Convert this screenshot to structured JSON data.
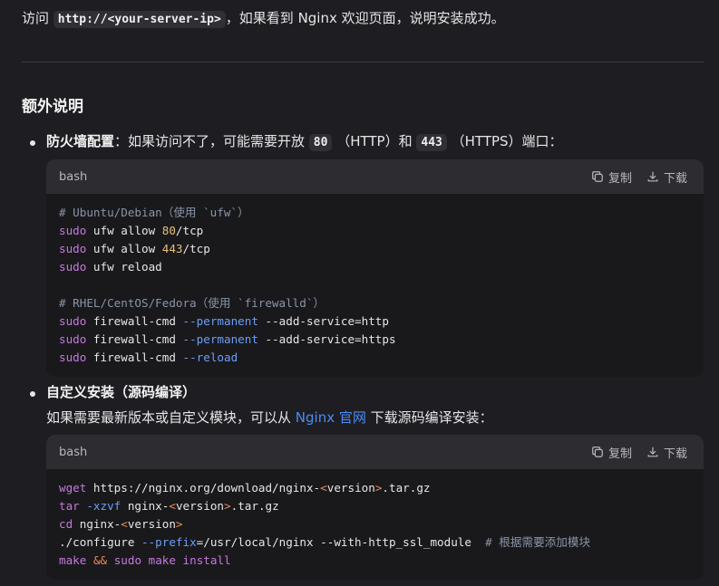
{
  "intro": {
    "prefix": "访问 ",
    "code": "http://<your-server-ip>",
    "suffix": "，如果看到 Nginx 欢迎页面，说明安装成功。"
  },
  "section_title": "额外说明",
  "firewall_item": {
    "bold": "防火墙配置",
    "text1": "：如果访问不了，可能需要开放 ",
    "code1": "80",
    "text2": " （HTTP）和 ",
    "code2": "443",
    "text3": " （HTTPS）端口："
  },
  "code_block_1": {
    "lang": "bash",
    "copy_label": "复制",
    "download_label": "下载",
    "lines": [
      [
        {
          "t": "# Ubuntu/Debian（使用 `ufw`）",
          "c": "com"
        }
      ],
      [
        {
          "t": "sudo",
          "c": "kw"
        },
        {
          "t": " ufw allow "
        },
        {
          "t": "80",
          "c": "num"
        },
        {
          "t": "/tcp"
        }
      ],
      [
        {
          "t": "sudo",
          "c": "kw"
        },
        {
          "t": " ufw allow "
        },
        {
          "t": "443",
          "c": "num"
        },
        {
          "t": "/tcp"
        }
      ],
      [
        {
          "t": "sudo",
          "c": "kw"
        },
        {
          "t": " ufw reload"
        }
      ],
      [],
      [
        {
          "t": "# RHEL/CentOS/Fedora（使用 `firewalld`）",
          "c": "com"
        }
      ],
      [
        {
          "t": "sudo",
          "c": "kw"
        },
        {
          "t": " firewall-cmd "
        },
        {
          "t": "--permanent",
          "c": "flag"
        },
        {
          "t": " --add-service=http"
        }
      ],
      [
        {
          "t": "sudo",
          "c": "kw"
        },
        {
          "t": " firewall-cmd "
        },
        {
          "t": "--permanent",
          "c": "flag"
        },
        {
          "t": " --add-service=https"
        }
      ],
      [
        {
          "t": "sudo",
          "c": "kw"
        },
        {
          "t": " firewall-cmd "
        },
        {
          "t": "--reload",
          "c": "flag"
        }
      ]
    ]
  },
  "custom_item": {
    "bold": "自定义安装（源码编译）",
    "desc_prefix": "如果需要最新版本或自定义模块，可以从 ",
    "link": "Nginx 官网",
    "desc_suffix": " 下载源码编译安装："
  },
  "code_block_2": {
    "lang": "bash",
    "copy_label": "复制",
    "download_label": "下载",
    "lines": [
      [
        {
          "t": "wget",
          "c": "kw"
        },
        {
          "t": " https://nginx.org/download/nginx-"
        },
        {
          "t": "<",
          "c": "op"
        },
        {
          "t": "version"
        },
        {
          "t": ">",
          "c": "op"
        },
        {
          "t": ".tar.gz"
        }
      ],
      [
        {
          "t": "tar",
          "c": "kw"
        },
        {
          "t": " "
        },
        {
          "t": "-xzvf",
          "c": "flag"
        },
        {
          "t": " nginx-"
        },
        {
          "t": "<",
          "c": "op"
        },
        {
          "t": "version"
        },
        {
          "t": ">",
          "c": "op"
        },
        {
          "t": ".tar.gz"
        }
      ],
      [
        {
          "t": "cd",
          "c": "kw"
        },
        {
          "t": " nginx-"
        },
        {
          "t": "<",
          "c": "op"
        },
        {
          "t": "version"
        },
        {
          "t": ">",
          "c": "op"
        }
      ],
      [
        {
          "t": "./configure "
        },
        {
          "t": "--prefix",
          "c": "flag"
        },
        {
          "t": "=/usr/local/nginx --with-http_ssl_module  "
        },
        {
          "t": "# 根据需要添加模块",
          "c": "com"
        }
      ],
      [
        {
          "t": "make",
          "c": "kw"
        },
        {
          "t": " "
        },
        {
          "t": "&&",
          "c": "op"
        },
        {
          "t": " "
        },
        {
          "t": "sudo",
          "c": "kw"
        },
        {
          "t": " make install",
          "c": "kw"
        }
      ]
    ]
  }
}
